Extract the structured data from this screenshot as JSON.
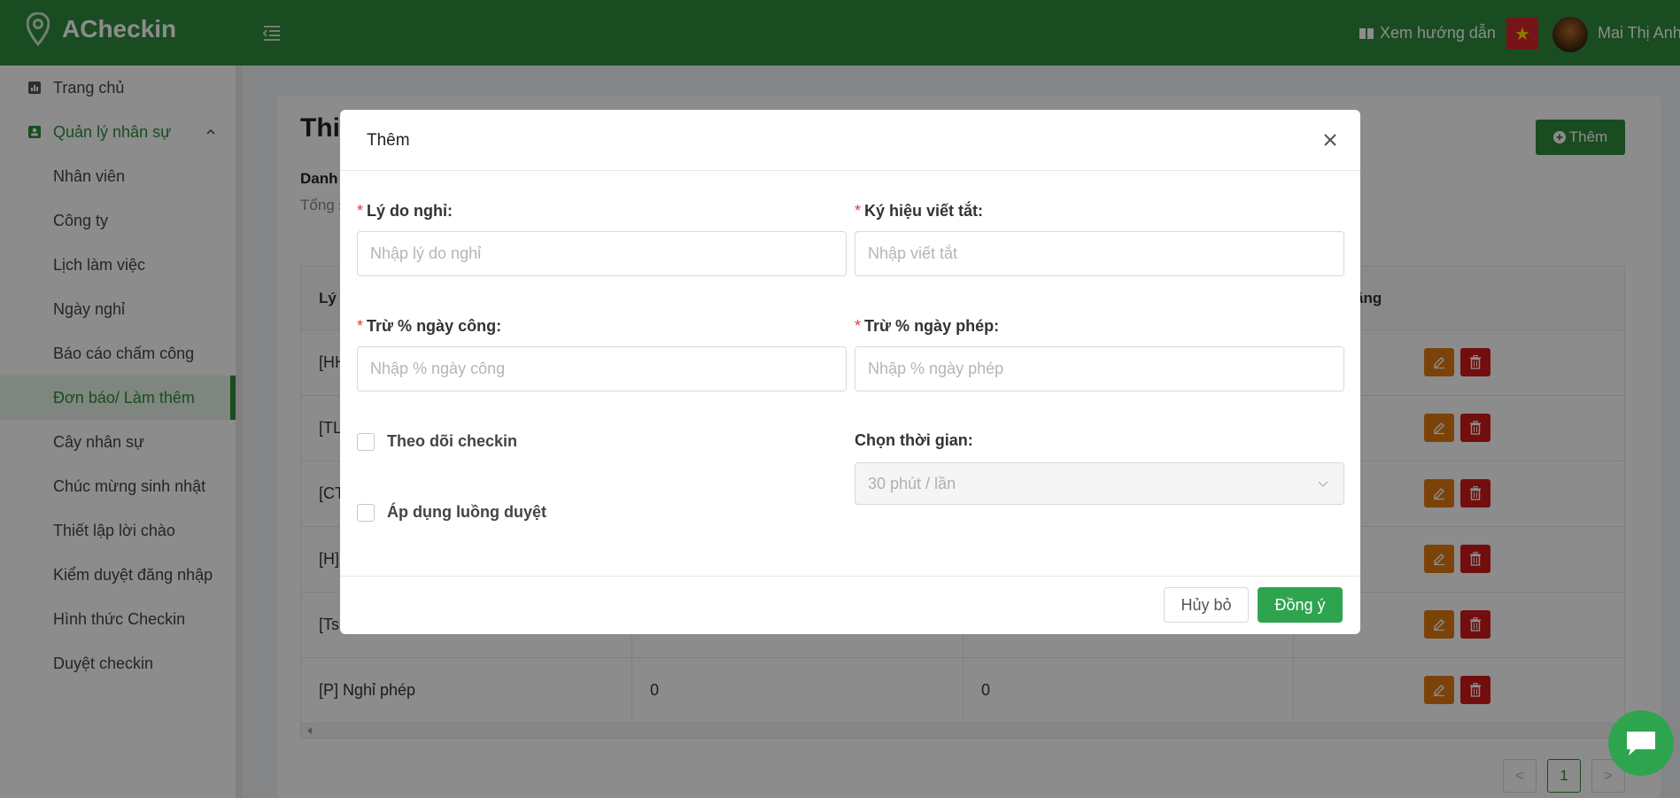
{
  "header": {
    "app_name": "ACheckin",
    "guide_label": "Xem hướng dẫn",
    "user_name": "Mai Thị Anh",
    "flag_glyph": "★"
  },
  "sidebar": {
    "items": [
      {
        "label": "Trang chủ",
        "icon": "chart-icon"
      },
      {
        "label": "Quản lý nhân sự",
        "icon": "user-card-icon"
      },
      {
        "label": "Nhân viên"
      },
      {
        "label": "Công ty"
      },
      {
        "label": "Lịch làm việc"
      },
      {
        "label": "Ngày nghỉ"
      },
      {
        "label": "Báo cáo chấm công"
      },
      {
        "label": "Đơn báo/ Làm thêm"
      },
      {
        "label": "Cây nhân sự"
      },
      {
        "label": "Chúc mừng sinh nhật"
      },
      {
        "label": "Thiết lập lời chào"
      },
      {
        "label": "Kiểm duyệt đăng nhập"
      },
      {
        "label": "Hình thức Checkin"
      },
      {
        "label": "Duyệt checkin"
      }
    ],
    "active_index": 7
  },
  "page": {
    "title": "Thi",
    "subtitle": "Danh",
    "count_text": "Tổng s",
    "add_button": "Thêm",
    "columns": [
      "Lý",
      "",
      "",
      "ăng"
    ],
    "rows": [
      {
        "c1": "[HH",
        "c2": "",
        "c3": ""
      },
      {
        "c1": "[TL",
        "c2": "",
        "c3": ""
      },
      {
        "c1": "[CT",
        "c2": "",
        "c3": ""
      },
      {
        "c1": "[H]",
        "c2": "",
        "c3": ""
      },
      {
        "c1": "[Ts",
        "c2": "",
        "c3": ""
      },
      {
        "c1": "[P] Nghỉ phép",
        "c2": "0",
        "c3": "0"
      }
    ],
    "pagination": {
      "prev": "<",
      "current": "1",
      "next": ">"
    }
  },
  "modal": {
    "title": "Thêm",
    "close": "X",
    "fields": {
      "reason": {
        "label": "Lý do nghỉ:",
        "placeholder": "Nhập lý do nghỉ",
        "value": ""
      },
      "abbr": {
        "label": "Ký hiệu viết tắt:",
        "placeholder": "Nhập viết tắt",
        "value": ""
      },
      "workday": {
        "label": "Trừ % ngày công:",
        "placeholder": "Nhập % ngày công",
        "value": ""
      },
      "leave": {
        "label": "Trừ % ngày phép:",
        "placeholder": "Nhập % ngày phép",
        "value": ""
      }
    },
    "track_checkin": {
      "label": "Theo dõi checkin",
      "checked": false
    },
    "apply_flow": {
      "label": "Áp dụng luồng duyệt",
      "checked": false
    },
    "time_select": {
      "label": "Chọn thời gian:",
      "value": "30 phút / lần"
    },
    "cancel_button": "Hủy bỏ",
    "ok_button": "Đồng ý"
  },
  "colors": {
    "brand_green": "#2e8b3c",
    "ok_green": "#2ea44f",
    "edit_orange": "#e07b12",
    "delete_red": "#d11a1a",
    "required_red": "#e53935"
  }
}
